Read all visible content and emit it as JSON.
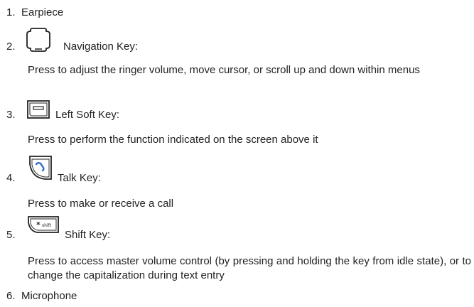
{
  "items": [
    {
      "number": "1.",
      "label": "Earpiece"
    },
    {
      "number": "2.",
      "label": "Navigation Key:",
      "icon": "navigation-key-icon",
      "description": "Press to adjust the ringer volume, move cursor, or scroll up and down within menus"
    },
    {
      "number": "3.",
      "label": "Left Soft Key:",
      "icon": "left-soft-key-icon",
      "description": "Press to perform the function indicated on the screen above it"
    },
    {
      "number": "4.",
      "label": "Talk Key:",
      "icon": "talk-key-icon",
      "description": "Press to make or receive a call"
    },
    {
      "number": "5.",
      "label": "Shift Key:",
      "icon": "shift-key-icon",
      "icon_text": "shift",
      "description": "Press to access master volume control (by pressing and holding the key from idle state), or to change the capitalization during text entry"
    },
    {
      "number": "6.",
      "label": "Microphone"
    }
  ]
}
